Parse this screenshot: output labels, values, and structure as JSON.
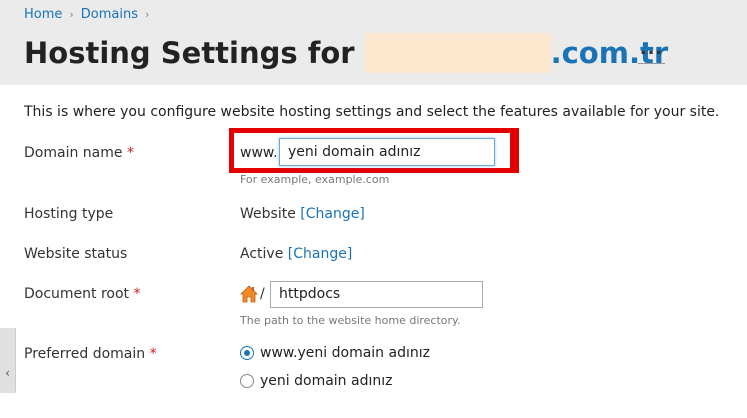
{
  "breadcrumb": {
    "items": [
      "Home",
      "Domains"
    ],
    "separator": "›"
  },
  "page": {
    "title_prefix": "Hosting Settings for",
    "title_suffix": ".com.tr",
    "more_label": "..."
  },
  "intro": "This is where you configure website hosting settings and select the features available for your site.",
  "form": {
    "domain_name": {
      "label": "Domain name",
      "required": "*",
      "prefix": "www.",
      "value": "yeni domain adınız",
      "hint": "For example, example.com"
    },
    "hosting_type": {
      "label": "Hosting type",
      "value": "Website",
      "change": "[Change]"
    },
    "website_status": {
      "label": "Website status",
      "value": "Active",
      "change": "[Change]"
    },
    "document_root": {
      "label": "Document root",
      "required": "*",
      "slash": "/",
      "value": "httpdocs",
      "hint": "The path to the website home directory."
    },
    "preferred_domain": {
      "label": "Preferred domain",
      "required": "*",
      "options": [
        "www.yeni domain adınız",
        "yeni domain adınız"
      ],
      "selected_index": 0
    }
  },
  "side_tab": {
    "icon": "chevron-left-icon",
    "glyph": "‹"
  },
  "colors": {
    "link": "#1a73b5",
    "highlight": "#e30000",
    "redaction": "#fde8cf"
  }
}
